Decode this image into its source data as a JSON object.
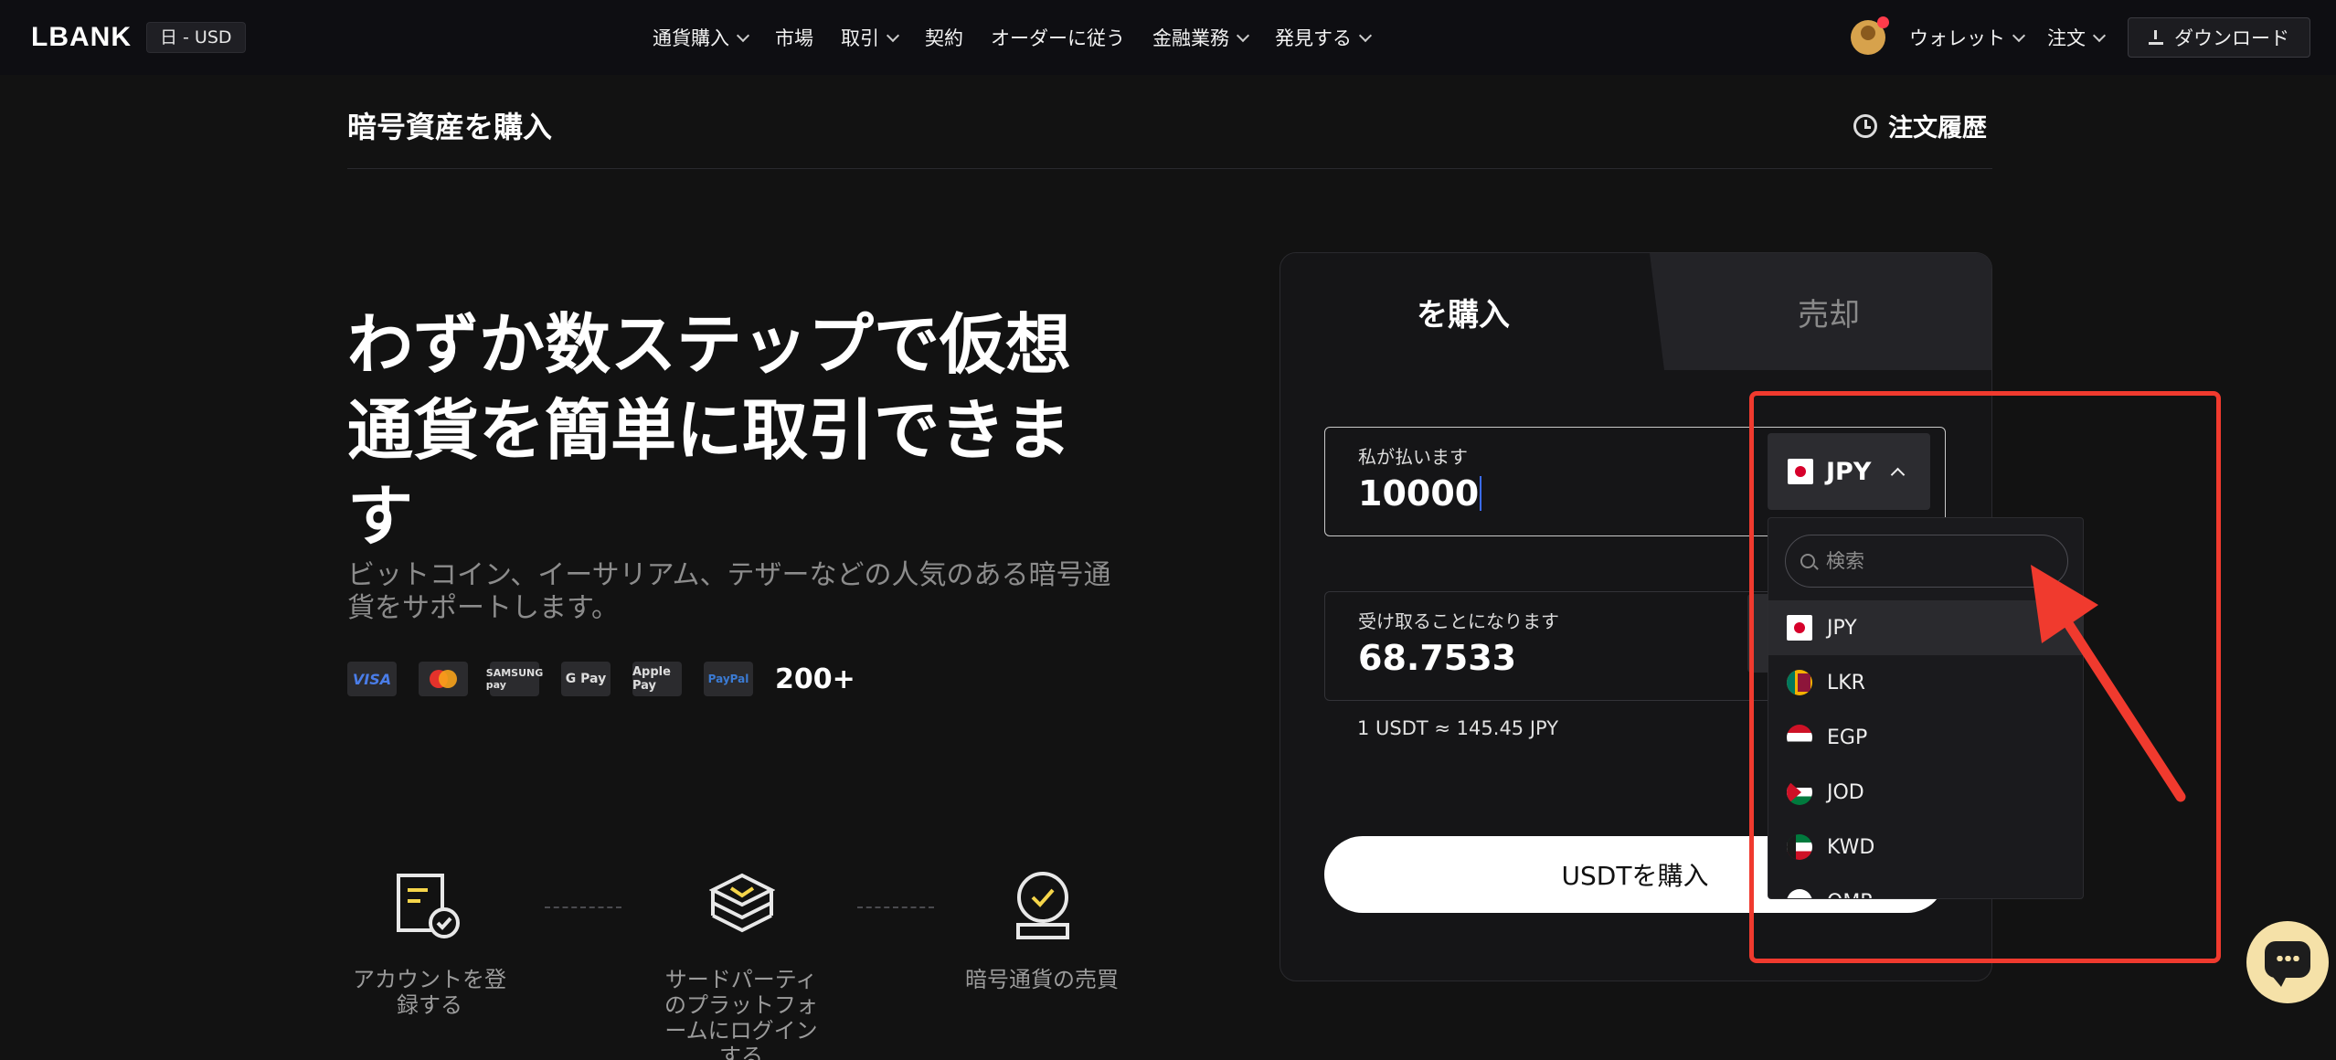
{
  "nav": {
    "logo": "LBANK",
    "locale": "日 - USD",
    "menu": [
      {
        "label": "通貨購入",
        "dropdown": true
      },
      {
        "label": "市場",
        "dropdown": false
      },
      {
        "label": "取引",
        "dropdown": true
      },
      {
        "label": "契約",
        "dropdown": false
      },
      {
        "label": "オーダーに従う",
        "dropdown": false
      },
      {
        "label": "金融業務",
        "dropdown": true
      },
      {
        "label": "発見する",
        "dropdown": true
      }
    ],
    "wallet": "ウォレット",
    "orders": "注文",
    "download": "ダウンロード"
  },
  "header": {
    "title": "暗号資産を購入",
    "history": "注文履歴"
  },
  "hero": {
    "line1": "わずか数ステップで仮想",
    "line2": "通貨を簡単に取引できま",
    "line3": "す",
    "subtitle": "ビットコイン、イーサリアム、テザーなどの人気のある暗号通貨をサポートします。",
    "payments": [
      "VISA",
      "Mastercard",
      "SAMSUNG pay",
      "G Pay",
      "Apple Pay",
      "PayPal"
    ],
    "payment_count": "200+"
  },
  "steps": [
    {
      "label": "アカウントを登録する"
    },
    {
      "label": "サードパーティのプラットフォームにログインする"
    },
    {
      "label": "暗号通貨の売買"
    }
  ],
  "card": {
    "tab_buy": "を購入",
    "tab_sell": "売却",
    "pay_label": "私が払います",
    "pay_value": "10000",
    "receive_label": "受け取ることになります",
    "receive_value": "68.7533",
    "rate": "1 USDT ≈ 145.45 JPY",
    "buy_button": "USDTを購入"
  },
  "currency": {
    "selected": "JPY",
    "search_placeholder": "検索",
    "options": [
      {
        "code": "JPY",
        "flag": "jp"
      },
      {
        "code": "LKR",
        "flag": "lk"
      },
      {
        "code": "EGP",
        "flag": "eg"
      },
      {
        "code": "JOD",
        "flag": "jo"
      },
      {
        "code": "KWD",
        "flag": "kw"
      },
      {
        "code": "OMR",
        "flag": "om"
      }
    ]
  },
  "colors": {
    "background": "#121212",
    "annotation": "#f03a2e",
    "accent_yellow": "#f5d54a"
  }
}
